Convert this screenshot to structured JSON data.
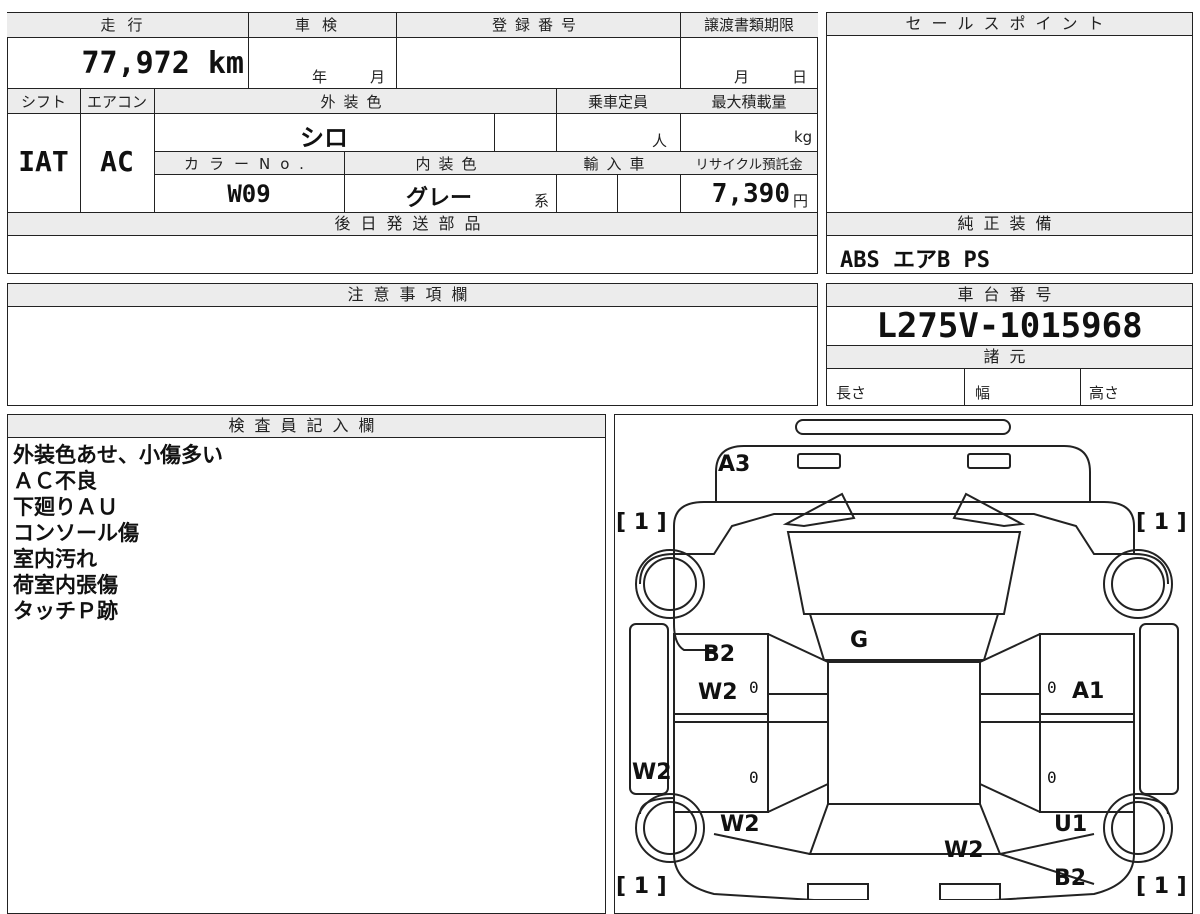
{
  "top": {
    "mileage_label": "走行",
    "shaken_label": "車検",
    "reg_label": "登録番号",
    "transfer_label": "譲渡書類期限",
    "mileage": "77,972 km",
    "year_unit": "年",
    "month_unit": "月",
    "transfer_month": "月",
    "transfer_day": "日",
    "shift_label": "シフト",
    "aircon_label": "エアコン",
    "ext_color_label": "外装色",
    "capacity_label": "乗車定員",
    "max_load_label": "最大積載量",
    "shift": "IAT",
    "aircon": "AC",
    "ext_color": "シロ",
    "capacity_unit": "人",
    "load_unit": "kg",
    "color_no_label": "カラーNo.",
    "int_color_label": "内装色",
    "import_label": "輸入車",
    "recycle_label": "リサイクル預託金",
    "color_no": "W09",
    "int_color": "グレー",
    "int_color_suffix": "系",
    "recycle_fee": "7,390",
    "yen": "円",
    "later_parts_label": "後日発送部品"
  },
  "right": {
    "sales_point_label": "セールスポイント",
    "genuine_label": "純正装備",
    "genuine_items": "ABS エアB PS",
    "chassis_label": "車台番号",
    "chassis_no": "L275V-1015968",
    "specs_label": "諸元",
    "length_label": "長さ",
    "width_label": "幅",
    "height_label": "高さ"
  },
  "notes_section": {
    "label": "注意事項欄"
  },
  "inspector": {
    "label": "検査員記入欄",
    "notes": [
      "外装色あせ、小傷多い",
      "ＡＣ不良",
      "下廻りＡＵ",
      "コンソール傷",
      "室内汚れ",
      "荷室内張傷",
      "タッチＰ跡"
    ]
  },
  "diagram": {
    "a3": "A3",
    "tire_fl": "[ 1 ]",
    "tire_fr": "[ 1 ]",
    "tire_rl": "[ 1 ]",
    "tire_rr": "[ 1 ]",
    "g": "G",
    "b2_left": "B2",
    "w2_left_door": "W2",
    "a1": "A1",
    "w2_left_side": "W2",
    "w2_rear_left": "W2",
    "u1": "U1",
    "w2_rear_center": "W2",
    "b2_rear": "B2",
    "zero_1": "0",
    "zero_2": "0",
    "zero_3": "0",
    "zero_4": "0"
  }
}
